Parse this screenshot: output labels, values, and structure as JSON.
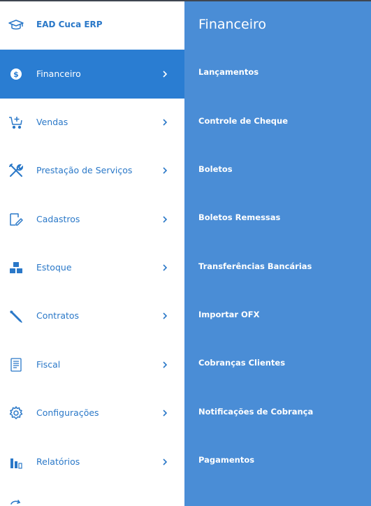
{
  "brand": {
    "title": "EAD Cuca ERP",
    "icon": "graduation-cap-icon"
  },
  "nav": [
    {
      "label": "Financeiro",
      "icon": "dollar-circle-icon",
      "active": true
    },
    {
      "label": "Vendas",
      "icon": "cart-add-icon"
    },
    {
      "label": "Prestação de Serviços",
      "icon": "tools-icon"
    },
    {
      "label": "Cadastros",
      "icon": "edit-icon"
    },
    {
      "label": "Estoque",
      "icon": "boxes-icon"
    },
    {
      "label": "Contratos",
      "icon": "pen-icon"
    },
    {
      "label": "Fiscal",
      "icon": "document-icon"
    },
    {
      "label": "Configurações",
      "icon": "gear-icon"
    },
    {
      "label": "Relatórios",
      "icon": "bar-chart-icon"
    }
  ],
  "submenu": {
    "title": "Financeiro",
    "items": [
      "Lançamentos",
      "Controle de Cheque",
      "Boletos",
      "Boletos Remessas",
      "Transferências Bancárias",
      "Importar OFX",
      "Cobranças Clientes",
      "Notificações de Cobrança",
      "Pagamentos"
    ]
  },
  "colors": {
    "accent": "#2a78c8",
    "active_bg": "#2a7dd2",
    "submenu_bg": "#4a8dd6",
    "text_on_accent": "#ffffff"
  }
}
